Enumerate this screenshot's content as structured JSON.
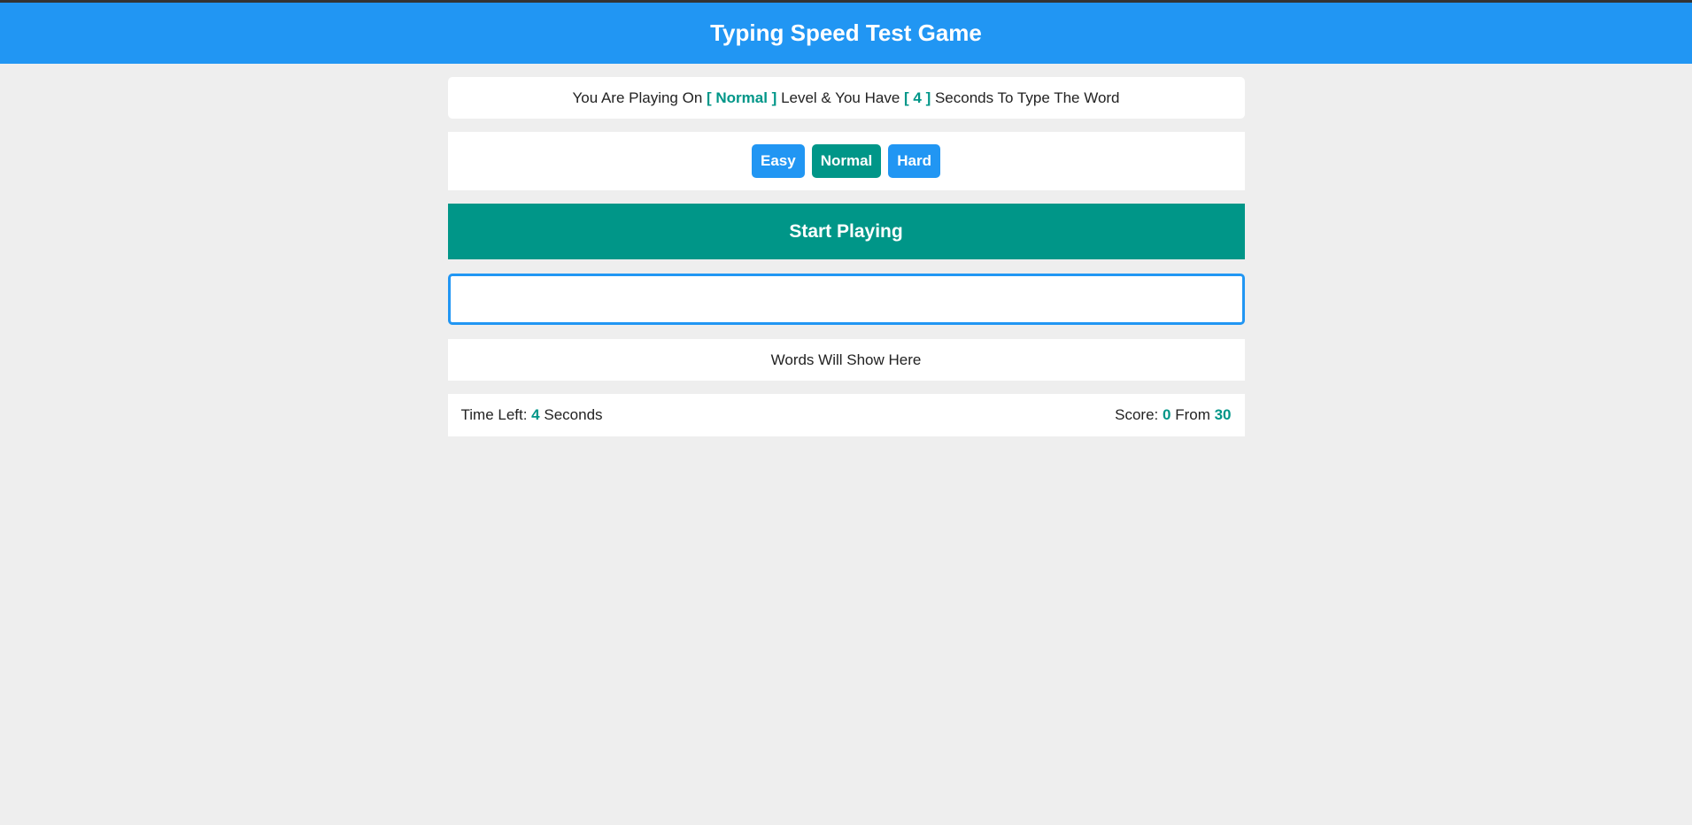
{
  "header": {
    "title": "Typing Speed Test Game"
  },
  "message": {
    "prefix": "You Are Playing On ",
    "level": "[ Normal ]",
    "middle": " Level & You Have ",
    "seconds": "[ 4 ]",
    "suffix": " Seconds To Type The Word"
  },
  "levels": [
    {
      "label": "Easy",
      "active": false
    },
    {
      "label": "Normal",
      "active": true
    },
    {
      "label": "Hard",
      "active": false
    }
  ],
  "start_label": "Start Playing",
  "input": {
    "value": "",
    "placeholder": ""
  },
  "words_placeholder": "Words Will Show Here",
  "control": {
    "time_label": "Time Left: ",
    "time_value": "4",
    "time_unit": " Seconds",
    "score_label": "Score: ",
    "score_value": "0",
    "score_from": " From ",
    "score_total": "30"
  },
  "colors": {
    "accent": "#2196f3",
    "highlight": "#009688",
    "background": "#eeeeee"
  }
}
